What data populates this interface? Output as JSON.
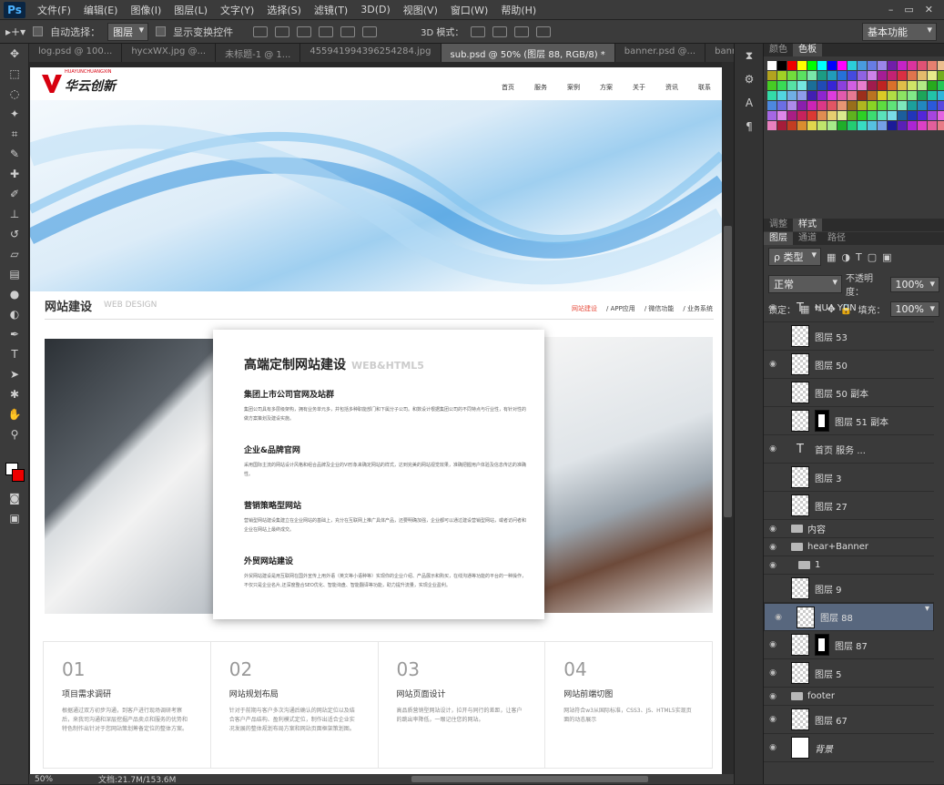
{
  "menubar": {
    "logo": "Ps",
    "items": [
      "文件(F)",
      "编辑(E)",
      "图像(I)",
      "图层(L)",
      "文字(Y)",
      "选择(S)",
      "滤镜(T)",
      "3D(D)",
      "视图(V)",
      "窗口(W)",
      "帮助(H)"
    ],
    "window_controls": [
      "–",
      "▭",
      "✕"
    ]
  },
  "options": {
    "auto_select_label": "自动选择：",
    "auto_select_value": "图层",
    "show_transform_label": "显示变换控件",
    "mode_3d_label": "3D 模式：",
    "workspace": "基本功能"
  },
  "tabs": [
    "log.psd @ 100...",
    "hycxWX.jpg @...",
    "未标题-1 @ 1...",
    "455941994396254284.jpg",
    "sub.psd @ 50% (图层 88, RGB/8) *",
    "banner.psd @...",
    "banner2..."
  ],
  "active_tab_index": 4,
  "status": {
    "zoom": "50%",
    "doc": "文档:21.7M/153.6M"
  },
  "panels": {
    "color_tabs": [
      "颜色",
      "色板"
    ],
    "adjust_tabs": [
      "调整",
      "样式"
    ],
    "layer_tabs": [
      "图层",
      "通道",
      "路径"
    ],
    "filter_label": "ρ 类型",
    "blend_mode": "正常",
    "opacity_label": "不透明度：",
    "opacity_value": "100%",
    "lock_label": "锁定：",
    "fill_label": "填充：",
    "fill_value": "100%"
  },
  "layers": [
    {
      "name": "HUA YUN",
      "type": "text",
      "eye": true
    },
    {
      "name": "图层 53",
      "type": "image",
      "eye": false
    },
    {
      "name": "图层 50",
      "type": "image",
      "eye": true
    },
    {
      "name": "图层 50 副本",
      "type": "image",
      "eye": false
    },
    {
      "name": "图层 51 副本",
      "type": "mask",
      "eye": false
    },
    {
      "name": "首页     服务   ...",
      "type": "text",
      "eye": true
    },
    {
      "name": "图层 3",
      "type": "image",
      "eye": false
    },
    {
      "name": "图层 27",
      "type": "image",
      "eye": false
    },
    {
      "name": "内容",
      "type": "folder",
      "eye": true
    },
    {
      "name": "hear+Banner",
      "type": "folder",
      "eye": true
    },
    {
      "name": "1",
      "type": "folder",
      "eye": true
    },
    {
      "name": "图层 9",
      "type": "image",
      "eye": false
    },
    {
      "name": "图层 88",
      "type": "image",
      "eye": true,
      "selected": true
    },
    {
      "name": "图层 87",
      "type": "mask",
      "eye": true
    },
    {
      "name": "图层 5",
      "type": "image",
      "eye": true
    },
    {
      "name": "footer",
      "type": "folder",
      "eye": true
    },
    {
      "name": "图层 67",
      "type": "image",
      "eye": true
    },
    {
      "name": "背景",
      "type": "bg",
      "eye": true
    }
  ],
  "site": {
    "logo_text": "华云创新",
    "logo_sub": "HUAYUNCHUANGXIN",
    "nav": [
      "首页",
      "服务",
      "案例",
      "方案",
      "关于",
      "资讯",
      "联系"
    ],
    "section_title": "网站建设",
    "section_sub": "WEB DESIGN",
    "section_nav": [
      "网站建设",
      "/  APP应用",
      "/  微信功能",
      "/  业务系统"
    ],
    "card_title": "高端定制网站建设",
    "card_title_en": "WEB&HTML5",
    "features": [
      {
        "title": "集团上市公司官网及站群",
        "desc": "集团公司具有多层级架构，拥有业务单元多，并包括多种职能部门和下属分子公司。和数设计根据集团公司的不同特点与行业性，有针对性的做方案策划及建设实施。"
      },
      {
        "title": "企业&品牌官网",
        "desc": "采用国际主流的网站设计风格和组合品牌及企业的VI形象来确定网站的样式，达到完美的网站视觉效果，准确把握用户体验及信息传达的准确性。"
      },
      {
        "title": "营销策略型网站",
        "desc": "营销型网站建设集建立在企业网站的基础上，充分在互联网上推广具体产品，还要明确加强，企业都可以通过建设营销型网站，或者访问者和企业在网站上最终成交。"
      },
      {
        "title": "外贸网站建设",
        "desc": "外贸网站建设是用互联网在国外宣传上用外语（英文等小语种等）实现你的企业介绍、产品展示和购买，在线沟通等功能的平台的一种操作，不仅只是企业名片,还深度整合SEO优化、智能询盘、智能翻译等功能，助力提升流量，实现企业盈利。"
      }
    ],
    "steps": [
      {
        "num": "01",
        "title": "项目需求调研",
        "desc": "根据通过双方初步沟通，到客户进行现场调研考察后，来我司沟通和深层挖掘产品卖点和服务的优势和特色制作出针对于您网站策划筹备定位的整体方案。"
      },
      {
        "num": "02",
        "title": "网站规划布局",
        "desc": "针对于前期与客户多次沟通后确认的网站定位以及结合客户产品结构、盈利模式定位，制作出适合企业实况发展的整体规划布局方案和网站页面框架策划图。"
      },
      {
        "num": "03",
        "title": "网站页面设计",
        "desc": "高品质营销型网站设计，拉开与同行的差距，让客户的跳出率降低，一眼记住您的网站。"
      },
      {
        "num": "04",
        "title": "网站前端切图",
        "desc": "网站符合w3从国际标准，CSS3、JS、HTML5实现页面的动态展示"
      }
    ]
  },
  "colors": {
    "accent_red": "#d7000f",
    "ps_bg": "#282828",
    "panel": "#3a3a3a",
    "selected_layer": "#58677e"
  }
}
